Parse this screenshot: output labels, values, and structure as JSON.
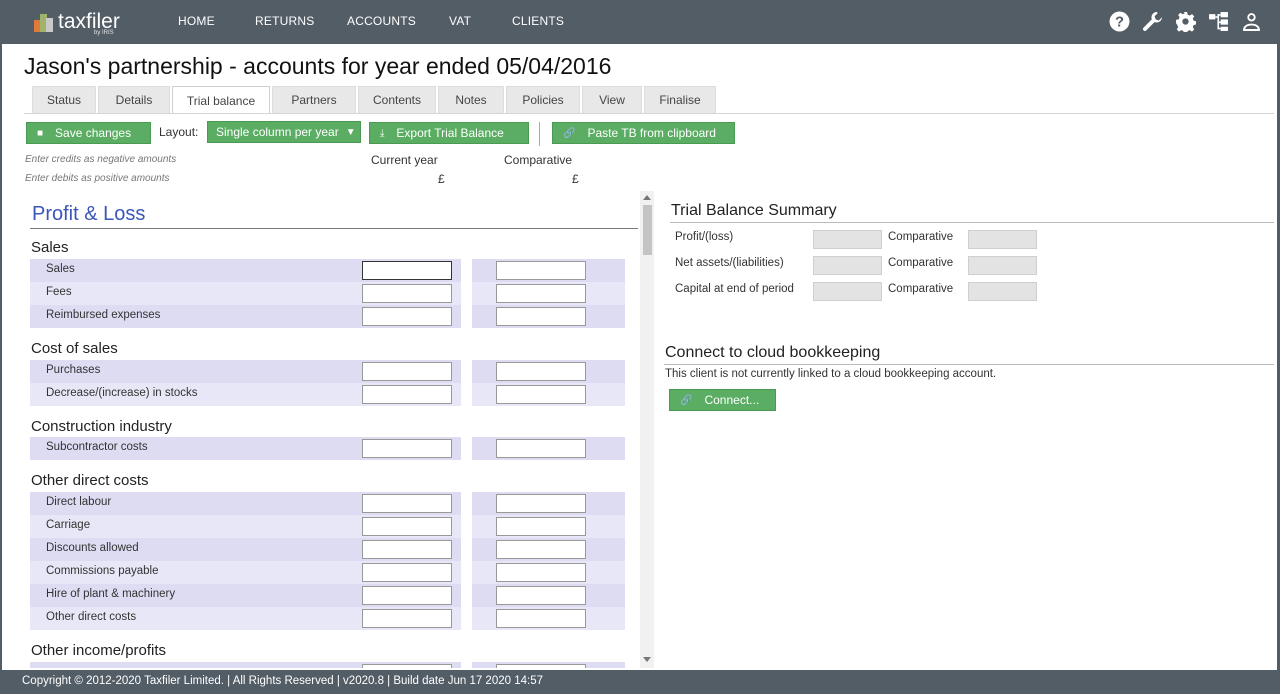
{
  "app": {
    "brand": "taxfiler",
    "brand_sub": "by IRIS"
  },
  "nav": [
    "HOME",
    "RETURNS",
    "ACCOUNTS",
    "VAT",
    "CLIENTS"
  ],
  "header_icons": [
    "help-icon",
    "wrench-icon",
    "gear-icon",
    "hierarchy-icon",
    "user-icon"
  ],
  "page": {
    "title": "Jason's partnership - accounts for year ended 05/04/2016"
  },
  "tabs": [
    "Status",
    "Details",
    "Trial balance",
    "Partners",
    "Contents",
    "Notes",
    "Policies",
    "View",
    "Finalise"
  ],
  "active_tab": "Trial balance",
  "toolbar": {
    "save_label": "Save changes",
    "layout_label": "Layout:",
    "layout_value": "Single column per year",
    "export_label": "Export Trial Balance",
    "paste_label": "Paste TB from clipboard"
  },
  "hints": {
    "credits": "Enter credits as negative amounts",
    "debits": "Enter debits as positive amounts"
  },
  "columns": {
    "current": "Current year",
    "comparative": "Comparative",
    "currency": "£"
  },
  "pl": {
    "heading": "Profit & Loss",
    "sections": [
      {
        "title": "Sales",
        "rows": [
          "Sales",
          "Fees",
          "Reimbursed expenses"
        ]
      },
      {
        "title": "Cost of sales",
        "rows": [
          "Purchases",
          "Decrease/(increase) in stocks"
        ]
      },
      {
        "title": "Construction industry",
        "rows": [
          "Subcontractor costs"
        ]
      },
      {
        "title": "Other direct costs",
        "rows": [
          "Direct labour",
          "Carriage",
          "Discounts allowed",
          "Commissions payable",
          "Hire of plant & machinery",
          "Other direct costs"
        ]
      },
      {
        "title": "Other income/profits",
        "rows": []
      }
    ]
  },
  "summary": {
    "heading": "Trial Balance Summary",
    "rows": [
      "Profit/(loss)",
      "Net assets/(liabilities)",
      "Capital at end of period"
    ],
    "comparative_label": "Comparative"
  },
  "cloud": {
    "heading": "Connect to cloud bookkeeping",
    "text": "This client is not currently linked to a cloud bookkeeping account.",
    "connect_label": "Connect..."
  },
  "footer": {
    "text": "Copyright © 2012-2020 Taxfiler Limited. | All Rights Reserved | v2020.8 | Build date Jun 17 2020 14:57"
  },
  "colors": {
    "nav_bg": "#535d66",
    "accent_green": "#5aad62",
    "heading_blue": "#3a56b8",
    "row_bg": "#dddcf3"
  }
}
